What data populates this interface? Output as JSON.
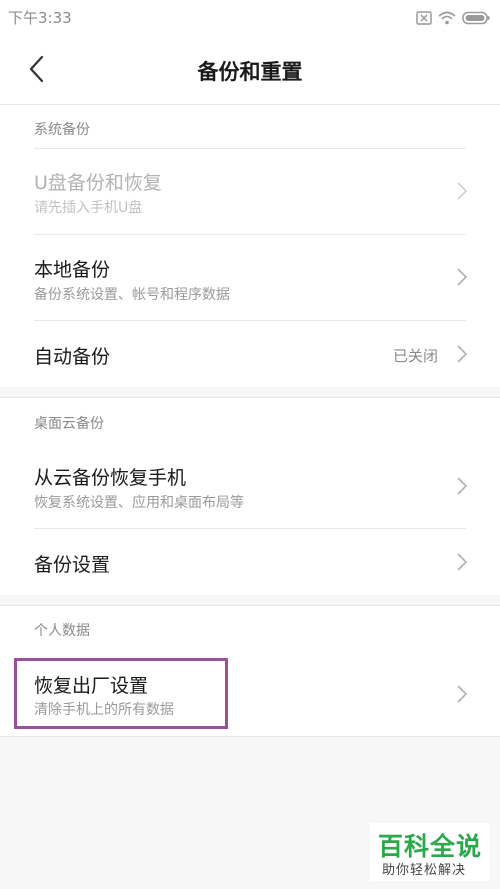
{
  "status_bar": {
    "time": "下午3:33",
    "icons": [
      "sim-off-icon",
      "wifi-icon",
      "battery-icon"
    ]
  },
  "header": {
    "title": "备份和重置",
    "back_icon": "chevron-left-icon"
  },
  "sections": [
    {
      "header": "系统备份",
      "items": [
        {
          "title": "U盘备份和恢复",
          "subtitle": "请先插入手机U盘",
          "disabled": true
        },
        {
          "title": "本地备份",
          "subtitle": "备份系统设置、帐号和程序数据"
        },
        {
          "title": "自动备份",
          "value": "已关闭"
        }
      ]
    },
    {
      "header": "桌面云备份",
      "items": [
        {
          "title": "从云备份恢复手机",
          "subtitle": "恢复系统设置、应用和桌面布局等"
        },
        {
          "title": "备份设置"
        }
      ]
    },
    {
      "header": "个人数据",
      "items": [
        {
          "title": "恢复出厂设置",
          "subtitle": "清除手机上的所有数据"
        }
      ]
    }
  ],
  "watermark": {
    "main": "百科全说",
    "sub": "助你轻松解决"
  },
  "colors": {
    "highlight_border": "#9c4f9b",
    "watermark_green": "#2aa84a"
  }
}
